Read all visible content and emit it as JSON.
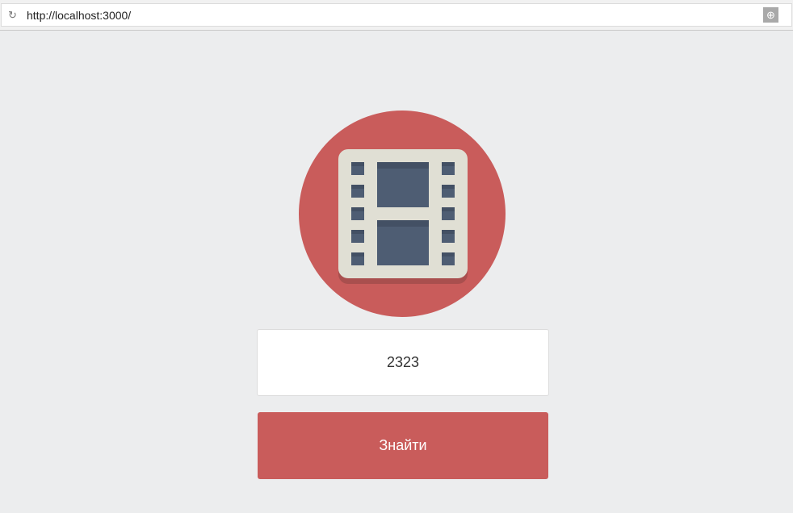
{
  "browser": {
    "url": "http://localhost:3000/"
  },
  "colors": {
    "accent": "#c95c5b",
    "background": "#ecedee"
  },
  "search": {
    "value": "2323"
  },
  "button": {
    "label": "Знайти"
  }
}
